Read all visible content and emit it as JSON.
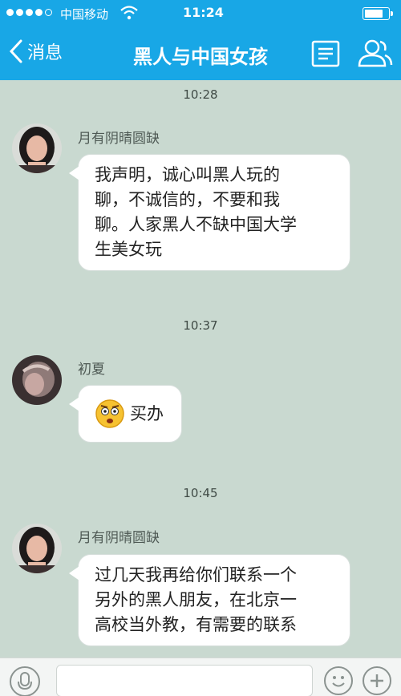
{
  "status_bar": {
    "carrier": "中国移动",
    "time": "11:24",
    "battery_level": 0.8
  },
  "nav": {
    "back_label": "消息",
    "title": "黑人与中国女孩"
  },
  "messages": [
    {
      "time": "10:28",
      "sender": "月有阴晴圆缺",
      "lines": [
        "我声明，诚心叫黑人玩的",
        "聊，不诚信的，不要和我",
        "聊。人家黑人不缺中国大学",
        "生美女玩"
      ]
    },
    {
      "time": "10:37",
      "sender": "初夏",
      "emoji": "dizzy-face",
      "text": "买办"
    },
    {
      "time": "10:45",
      "sender": "月有阴晴圆缺",
      "lines": [
        "过几天我再给你们联系一个",
        "另外的黑人朋友，在北京一",
        "高校当外教，有需要的联系"
      ]
    }
  ],
  "colors": {
    "accent": "#18a7e6",
    "chat_background": "#c9d9d0",
    "bubble": "#ffffff"
  }
}
